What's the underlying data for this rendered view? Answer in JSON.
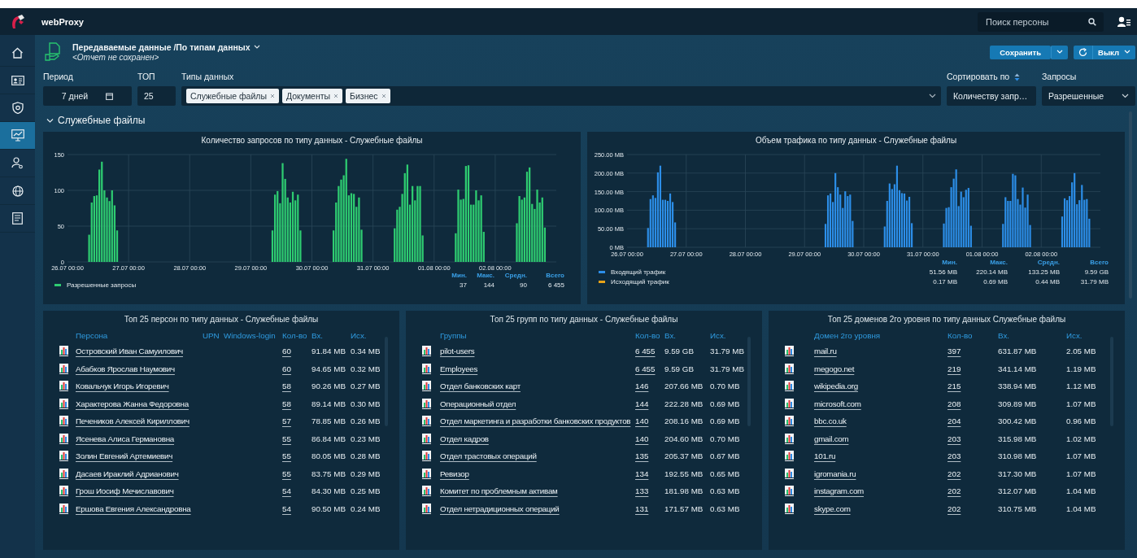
{
  "app": {
    "title": "webProxy"
  },
  "search": {
    "placeholder": "Поиск персоны"
  },
  "sidebar": {
    "items": [
      {
        "selected": false
      },
      {
        "selected": false
      },
      {
        "selected": false
      },
      {
        "selected": true
      },
      {
        "selected": false
      },
      {
        "selected": false
      },
      {
        "selected": false
      }
    ]
  },
  "report": {
    "title": "Передаваемые данные /По типам данных",
    "subtitle": "<Отчет не сохранен>"
  },
  "actions": {
    "save": "Сохранить",
    "refresh": "Выкл"
  },
  "filters": {
    "period": {
      "label": "Период",
      "value": "7 дней"
    },
    "top": {
      "label": "ТОП",
      "value": "25"
    },
    "types": {
      "label": "Типы данных",
      "chips": [
        "Служебные файлы",
        "Документы",
        "Бизнес"
      ]
    },
    "sort": {
      "label": "Сортировать по",
      "value": "Количеству запр…"
    },
    "requests": {
      "label": "Запросы",
      "value": "Разрешенные"
    }
  },
  "section": {
    "title": "Служебные файлы",
    "expanded": true
  },
  "charts": [
    {
      "chart_data": {
        "type": "bar",
        "title": "Количество запросов по типу данных - Служебные файлы",
        "categories": [
          "26.07 00:00",
          null,
          null,
          null,
          null,
          null,
          null,
          null,
          null,
          null,
          null,
          null,
          null,
          null,
          null,
          null,
          null,
          null,
          null,
          null,
          null,
          null,
          null,
          null,
          "27.07 00:00",
          null,
          null,
          null,
          null,
          null,
          null,
          null,
          null,
          null,
          null,
          null,
          null,
          null,
          null,
          null,
          null,
          null,
          null,
          null,
          null,
          null,
          null,
          null,
          "28.07 00:00",
          null,
          null,
          null,
          null,
          null,
          null,
          null,
          null,
          null,
          null,
          null,
          null,
          null,
          null,
          null,
          null,
          null,
          null,
          null,
          null,
          null,
          null,
          null,
          "29.07 00:00",
          null,
          null,
          null,
          null,
          null,
          null,
          null,
          null,
          null,
          null,
          null,
          null,
          null,
          null,
          null,
          null,
          null,
          null,
          null,
          null,
          null,
          null,
          null,
          "30.07 00:00",
          null,
          null,
          null,
          null,
          null,
          null,
          null,
          null,
          null,
          null,
          null,
          null,
          null,
          null,
          null,
          null,
          null,
          null,
          null,
          null,
          null,
          null,
          null,
          "31.07 00:00",
          null,
          null,
          null,
          null,
          null,
          null,
          null,
          null,
          null,
          null,
          null,
          null,
          null,
          null,
          null,
          null,
          null,
          null,
          null,
          null,
          null,
          null,
          null,
          "01.08 00:00",
          null,
          null,
          null,
          null,
          null,
          null,
          null,
          null,
          null,
          null,
          null,
          null,
          null,
          null,
          null,
          null,
          null,
          null,
          null,
          null,
          null,
          null,
          null,
          "02.08 00:00",
          null,
          null,
          null,
          null,
          null,
          null,
          null,
          null,
          null,
          null,
          null,
          null,
          null,
          null,
          null,
          null,
          null,
          null,
          null,
          null,
          null,
          null,
          null
        ],
        "series": [
          {
            "name": "Разрешенные запросы",
            "color": "#2ecc71",
            "values": [
              null,
              null,
              null,
              null,
              null,
              null,
              null,
              null,
              38,
              83,
              92,
              93,
              129,
              140,
              100,
              90,
              85,
              100,
              79,
              44,
              null,
              null,
              null,
              null,
              null,
              null,
              null,
              null,
              null,
              null,
              null,
              null,
              null,
              null,
              null,
              null,
              null,
              null,
              null,
              null,
              null,
              null,
              null,
              null,
              null,
              null,
              null,
              null,
              null,
              null,
              null,
              null,
              null,
              null,
              null,
              null,
              null,
              null,
              null,
              null,
              null,
              null,
              null,
              null,
              null,
              null,
              null,
              null,
              null,
              null,
              null,
              null,
              null,
              null,
              null,
              null,
              null,
              null,
              null,
              null,
              44,
              94,
              99,
              82,
              138,
              116,
              90,
              83,
              98,
              86,
              94,
              44,
              null,
              null,
              null,
              null,
              null,
              null,
              null,
              null,
              null,
              null,
              null,
              null,
              44,
              83,
              106,
              115,
              121,
              144,
              93,
              96,
              95,
              77,
              90,
              45,
              null,
              null,
              null,
              null,
              null,
              null,
              null,
              null,
              null,
              null,
              null,
              null,
              47,
              73,
              77,
              95,
              124,
              136,
              80,
              106,
              86,
              106,
              106,
              37,
              null,
              null,
              null,
              null,
              null,
              null,
              null,
              null,
              null,
              null,
              null,
              null,
              40,
              101,
              87,
              88,
              134,
              135,
              80,
              80,
              100,
              86,
              93,
              42,
              null,
              null,
              null,
              null,
              null,
              null,
              null,
              null,
              null,
              null,
              null,
              null,
              54,
              92,
              87,
              90,
              126,
              132,
              81,
              74,
              101,
              83,
              90,
              48,
              null,
              null,
              null,
              null
            ]
          }
        ],
        "ylim": [
          0,
          150
        ],
        "yticks": [
          0,
          50,
          100,
          150
        ],
        "grid": true
      },
      "stats": {
        "columns": [
          "Мин.",
          "Макс.",
          "Средн.",
          "Всего"
        ],
        "rows": [
          [
            "37",
            "144",
            "90",
            "6 455"
          ]
        ]
      }
    },
    {
      "chart_data": {
        "type": "bar",
        "title": "Объем трафика по типу данных - Служебные файлы",
        "categories": [
          "26.07 00:00",
          null,
          null,
          null,
          null,
          null,
          null,
          null,
          null,
          null,
          null,
          null,
          null,
          null,
          null,
          null,
          null,
          null,
          null,
          null,
          null,
          null,
          null,
          null,
          "27.07 00:00",
          null,
          null,
          null,
          null,
          null,
          null,
          null,
          null,
          null,
          null,
          null,
          null,
          null,
          null,
          null,
          null,
          null,
          null,
          null,
          null,
          null,
          null,
          null,
          "28.07 00:00",
          null,
          null,
          null,
          null,
          null,
          null,
          null,
          null,
          null,
          null,
          null,
          null,
          null,
          null,
          null,
          null,
          null,
          null,
          null,
          null,
          null,
          null,
          null,
          "29.07 00:00",
          null,
          null,
          null,
          null,
          null,
          null,
          null,
          null,
          null,
          null,
          null,
          null,
          null,
          null,
          null,
          null,
          null,
          null,
          null,
          null,
          null,
          null,
          null,
          "30.07 00:00",
          null,
          null,
          null,
          null,
          null,
          null,
          null,
          null,
          null,
          null,
          null,
          null,
          null,
          null,
          null,
          null,
          null,
          null,
          null,
          null,
          null,
          null,
          null,
          "31.07 00:00",
          null,
          null,
          null,
          null,
          null,
          null,
          null,
          null,
          null,
          null,
          null,
          null,
          null,
          null,
          null,
          null,
          null,
          null,
          null,
          null,
          null,
          null,
          null,
          "01.08 00:00",
          null,
          null,
          null,
          null,
          null,
          null,
          null,
          null,
          null,
          null,
          null,
          null,
          null,
          null,
          null,
          null,
          null,
          null,
          null,
          null,
          null,
          null,
          null,
          "02.08 00:00",
          null,
          null,
          null,
          null,
          null,
          null,
          null,
          null,
          null,
          null,
          null,
          null,
          null,
          null,
          null,
          null,
          null,
          null,
          null,
          null,
          null,
          null,
          null
        ],
        "series": [
          {
            "name": "Входящий трафик",
            "color": "#2c8ee8",
            "values": [
              null,
              null,
              null,
              null,
              null,
              null,
              null,
              null,
              52,
              130,
              140,
              133,
              202,
              220,
              128,
              128,
              125,
              145,
              122,
              67,
              null,
              null,
              null,
              null,
              null,
              null,
              null,
              null,
              null,
              null,
              null,
              null,
              null,
              null,
              null,
              null,
              null,
              null,
              null,
              null,
              null,
              null,
              null,
              null,
              null,
              null,
              null,
              null,
              null,
              null,
              null,
              null,
              null,
              null,
              null,
              null,
              null,
              null,
              null,
              null,
              null,
              null,
              null,
              null,
              null,
              null,
              null,
              null,
              null,
              null,
              null,
              null,
              null,
              null,
              null,
              null,
              null,
              null,
              null,
              null,
              63,
              140,
              145,
              122,
              200,
              162,
              142,
              106,
              151,
              138,
              142,
              71,
              null,
              null,
              null,
              null,
              null,
              null,
              null,
              null,
              null,
              null,
              null,
              null,
              56,
              125,
              172,
              157,
              170,
              220,
              154,
              146,
              145,
              126,
              136,
              65,
              null,
              null,
              null,
              null,
              null,
              null,
              null,
              null,
              null,
              null,
              null,
              null,
              64,
              106,
              108,
              162,
              185,
              210,
              111,
              150,
              135,
              155,
              160,
              58,
              null,
              null,
              null,
              null,
              null,
              null,
              null,
              null,
              null,
              null,
              null,
              null,
              63,
              135,
              125,
              125,
              198,
              194,
              130,
              115,
              161,
              107,
              142,
              60,
              null,
              null,
              null,
              null,
              null,
              null,
              null,
              null,
              null,
              null,
              null,
              null,
              83,
              132,
              127,
              138,
              175,
              200,
              116,
              127,
              168,
              128,
              130,
              77,
              null,
              null,
              null,
              null
            ]
          },
          {
            "name": "Исходящий трафик",
            "color": "#e8a317",
            "values": [
              null,
              null,
              null,
              null,
              null,
              null,
              null,
              null,
              null,
              null,
              null,
              null,
              null,
              null,
              null,
              null,
              null,
              null,
              null,
              null,
              null,
              null,
              null,
              null,
              null,
              null,
              null,
              null,
              null,
              null,
              null,
              null,
              null,
              null,
              null,
              null,
              null,
              null,
              null,
              null,
              null,
              null,
              null,
              null,
              null,
              null,
              null,
              null,
              null,
              null,
              null,
              null,
              null,
              null,
              null,
              null,
              null,
              null,
              null,
              null,
              null,
              null,
              null,
              null,
              null,
              null,
              null,
              null,
              null,
              null,
              null,
              null,
              null,
              null,
              null,
              null,
              null,
              null,
              null,
              null,
              null,
              null,
              null,
              null,
              null,
              null,
              null,
              null,
              null,
              null,
              null,
              null,
              null,
              null,
              null,
              null,
              null,
              null,
              null,
              null,
              null,
              null,
              null,
              null,
              null,
              null,
              null,
              null,
              null,
              null,
              null,
              null,
              null,
              null,
              null,
              null,
              null,
              null,
              null,
              null,
              null,
              null,
              null,
              null,
              null,
              null,
              null,
              null,
              null,
              null,
              null,
              null,
              null,
              null,
              null,
              null,
              null,
              null,
              null,
              null,
              null,
              null,
              null,
              null,
              null,
              null,
              null,
              null,
              null,
              null,
              null,
              null,
              null,
              null,
              null,
              null,
              null,
              null,
              null,
              null,
              null,
              null,
              null,
              null,
              null,
              null,
              null,
              null,
              null,
              null,
              null,
              null,
              null,
              null,
              null,
              null,
              null,
              null,
              null,
              null,
              null,
              null,
              null,
              null,
              null,
              null,
              null,
              null,
              null,
              null,
              null,
              null
            ]
          }
        ],
        "ylim": [
          0,
          250
        ],
        "grid": true,
        "yticks": [
          {
            "value": 0,
            "label": "0 MB"
          },
          {
            "value": 50,
            "label": "50.00 MB"
          },
          {
            "value": 100,
            "label": "100.00 MB"
          },
          {
            "value": 150,
            "label": "150.00 MB"
          },
          {
            "value": 200,
            "label": "200.00 MB"
          },
          {
            "value": 250,
            "label": "250.00 MB"
          }
        ]
      },
      "stats": {
        "columns": [
          "Мин.",
          "Макс.",
          "Средн.",
          "Всего"
        ],
        "rows": [
          [
            "51.56 MB",
            "220.14 MB",
            "133.25 MB",
            "9.59 GB"
          ],
          [
            "0.17 MB",
            "0.69 MB",
            "0.44 MB",
            "31.79 MB"
          ]
        ]
      }
    }
  ],
  "tables": [
    {
      "kind": "persons",
      "title": "Топ 25 персон по типу данных - Служебные файлы",
      "columns": [
        {
          "label": "Персона",
          "kind": "name"
        },
        {
          "label": "UPN",
          "kind": "blank"
        },
        {
          "label": "Windows-login",
          "kind": "blank"
        },
        {
          "label": "Кол-во",
          "kind": "count"
        },
        {
          "label": "Вх.",
          "kind": "in"
        },
        {
          "label": "Исх.",
          "kind": "out"
        }
      ],
      "rows": [
        {
          "name": "Островский Иван Самуилович",
          "count": "60",
          "in": "91.84 MB",
          "out": "0.34 MB"
        },
        {
          "name": "Абабков Ярослав Наумович",
          "count": "60",
          "in": "94.65 MB",
          "out": "0.32 MB"
        },
        {
          "name": "Ковальчук Игорь Игоревич",
          "count": "58",
          "in": "90.26 MB",
          "out": "0.27 MB"
        },
        {
          "name": "Характерова Жанна Федоровна",
          "count": "58",
          "in": "89.14 MB",
          "out": "0.30 MB"
        },
        {
          "name": "Печеников Алексей Кириллович",
          "count": "57",
          "in": "78.85 MB",
          "out": "0.26 MB"
        },
        {
          "name": "Ясенева Алиса Германовна",
          "count": "55",
          "in": "86.84 MB",
          "out": "0.23 MB"
        },
        {
          "name": "Золин Евгений Артемиевич",
          "count": "55",
          "in": "80.05 MB",
          "out": "0.28 MB"
        },
        {
          "name": "Дасаев Ираклий Адрианович",
          "count": "55",
          "in": "83.75 MB",
          "out": "0.29 MB"
        },
        {
          "name": "Грош Иосиф Мечиславович",
          "count": "54",
          "in": "84.30 MB",
          "out": "0.25 MB"
        },
        {
          "name": "Ершова Евгения Александровна",
          "count": "54",
          "in": "90.50 MB",
          "out": "0.24 MB"
        }
      ]
    },
    {
      "kind": "groups",
      "title": "Топ 25 групп по типу данных - Служебные файлы",
      "columns": [
        {
          "label": "Группы",
          "kind": "name"
        },
        {
          "label": "Кол-во",
          "kind": "count"
        },
        {
          "label": "Вх.",
          "kind": "in"
        },
        {
          "label": "Исх.",
          "kind": "out"
        }
      ],
      "rows": [
        {
          "name": "pilot-users",
          "count": "6 455",
          "in": "9.59 GB",
          "out": "31.79 MB"
        },
        {
          "name": "Employees",
          "count": "6 455",
          "in": "9.59 GB",
          "out": "31.79 MB"
        },
        {
          "name": "Отдел банковских карт",
          "count": "146",
          "in": "207.66 MB",
          "out": "0.70 MB"
        },
        {
          "name": "Операционный отдел",
          "count": "144",
          "in": "222.28 MB",
          "out": "0.69 MB"
        },
        {
          "name": "Отдел маркетинга и разработки банковских продуктов",
          "count": "140",
          "in": "208.16 MB",
          "out": "0.69 MB"
        },
        {
          "name": "Отдел кадров",
          "count": "140",
          "in": "204.60 MB",
          "out": "0.70 MB"
        },
        {
          "name": "Отдел трастовых операций",
          "count": "135",
          "in": "205.37 MB",
          "out": "0.67 MB"
        },
        {
          "name": "Ревизор",
          "count": "134",
          "in": "192.55 MB",
          "out": "0.65 MB"
        },
        {
          "name": "Комитет по проблемным активам",
          "count": "133",
          "in": "181.98 MB",
          "out": "0.63 MB"
        },
        {
          "name": "Отдел нетрадиционных операций",
          "count": "131",
          "in": "171.57 MB",
          "out": "0.63 MB"
        }
      ]
    },
    {
      "kind": "domains",
      "title": "Топ 25 доменов 2го уровня по типу данных Служебные файлы",
      "columns": [
        {
          "label": "Домен 2го уровня",
          "kind": "name"
        },
        {
          "label": "Кол-во",
          "kind": "count"
        },
        {
          "label": "Вх.",
          "kind": "in"
        },
        {
          "label": "Исх.",
          "kind": "out"
        }
      ],
      "rows": [
        {
          "name": "mail.ru",
          "count": "397",
          "in": "631.87 MB",
          "out": "2.05 MB"
        },
        {
          "name": "megogo.net",
          "count": "219",
          "in": "341.14 MB",
          "out": "1.19 MB"
        },
        {
          "name": "wikipedia.org",
          "count": "215",
          "in": "338.94 MB",
          "out": "1.12 MB"
        },
        {
          "name": "microsoft.com",
          "count": "208",
          "in": "309.89 MB",
          "out": "1.07 MB"
        },
        {
          "name": "bbc.co.uk",
          "count": "204",
          "in": "300.42 MB",
          "out": "0.96 MB"
        },
        {
          "name": "gmail.com",
          "count": "203",
          "in": "315.98 MB",
          "out": "1.02 MB"
        },
        {
          "name": "101.ru",
          "count": "203",
          "in": "310.98 MB",
          "out": "1.07 MB"
        },
        {
          "name": "igromania.ru",
          "count": "202",
          "in": "317.30 MB",
          "out": "1.07 MB"
        },
        {
          "name": "instagram.com",
          "count": "202",
          "in": "312.07 MB",
          "out": "1.04 MB"
        },
        {
          "name": "skype.com",
          "count": "202",
          "in": "310.75 MB",
          "out": "1.04 MB"
        }
      ]
    }
  ]
}
